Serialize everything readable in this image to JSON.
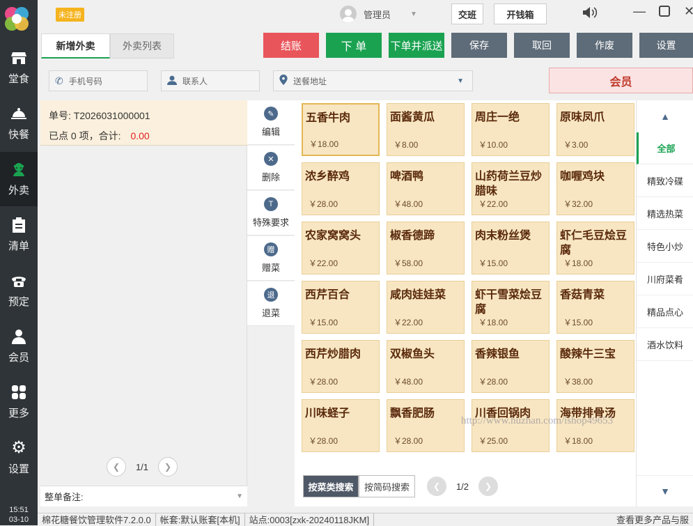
{
  "nav": {
    "items": [
      {
        "label": "堂食",
        "icon": "storefront-icon"
      },
      {
        "label": "快餐",
        "icon": "food-cloche-icon"
      },
      {
        "label": "外卖",
        "icon": "delivery-person-icon"
      },
      {
        "label": "清单",
        "icon": "clipboard-icon"
      },
      {
        "label": "预定",
        "icon": "phone-icon"
      },
      {
        "label": "会员",
        "icon": "user-icon"
      },
      {
        "label": "更多",
        "icon": "grid-icon"
      },
      {
        "label": "设置",
        "icon": "gear-icon"
      }
    ],
    "time": "15:51",
    "date": "03-10"
  },
  "topbar": {
    "badge": "未注册",
    "user": "管理员",
    "shift_btn": "交班",
    "drawer_btn": "开钱箱"
  },
  "tabs": [
    {
      "label": "新增外卖"
    },
    {
      "label": "外卖列表"
    }
  ],
  "actions": {
    "checkout": "结账",
    "order": "下 单",
    "order_dispatch": "下单并派送",
    "save": "保存",
    "recall": "取回",
    "void": "作废",
    "settings": "设置"
  },
  "search": {
    "phone": "手机号码",
    "contact": "联系人",
    "address": "送餐地址",
    "member": "会员"
  },
  "order": {
    "no_label": "单号:",
    "no": "T2026031000001",
    "summary": "已点 0 项，合计:",
    "total": "0.00",
    "page": "1/1",
    "remark_label": "整单备注:"
  },
  "tools": [
    {
      "label": "编辑",
      "icon": "pencil-icon",
      "glyph": "✎"
    },
    {
      "label": "删除",
      "icon": "close-icon",
      "glyph": "✕"
    },
    {
      "label": "特殊要求",
      "icon": "t-icon",
      "glyph": "T"
    },
    {
      "label": "赠菜",
      "icon": "gift-icon",
      "glyph": "赠"
    },
    {
      "label": "退菜",
      "icon": "return-icon",
      "glyph": "退"
    }
  ],
  "dishes": [
    {
      "name": "五香牛肉",
      "price": "￥18.00"
    },
    {
      "name": "面酱黄瓜",
      "price": "￥8.00"
    },
    {
      "name": "周庄一绝",
      "price": "￥10.00"
    },
    {
      "name": "原味凤爪",
      "price": "￥3.00"
    },
    {
      "name": "浓乡醉鸡",
      "price": "￥28.00"
    },
    {
      "name": "啤酒鸭",
      "price": "￥48.00"
    },
    {
      "name": "山药荷兰豆炒腊味",
      "price": "￥22.00"
    },
    {
      "name": "咖喱鸡块",
      "price": "￥32.00"
    },
    {
      "name": "农家窝窝头",
      "price": "￥22.00"
    },
    {
      "name": "椒香德蹄",
      "price": "￥58.00"
    },
    {
      "name": "肉末粉丝煲",
      "price": "￥15.00"
    },
    {
      "name": "虾仁毛豆烩豆腐",
      "price": "￥18.00"
    },
    {
      "name": "西芹百合",
      "price": "￥15.00"
    },
    {
      "name": "咸肉娃娃菜",
      "price": "￥22.00"
    },
    {
      "name": "虾干雪菜烩豆腐",
      "price": "￥18.00"
    },
    {
      "name": "香菇青菜",
      "price": "￥15.00"
    },
    {
      "name": "西芹炒腊肉",
      "price": "￥28.00"
    },
    {
      "name": "双椒鱼头",
      "price": "￥48.00"
    },
    {
      "name": "香辣银鱼",
      "price": "￥28.00"
    },
    {
      "name": "酸辣牛三宝",
      "price": "￥38.00"
    },
    {
      "name": "川味蛏子",
      "price": "￥28.00"
    },
    {
      "name": "飘香肥肠",
      "price": "￥28.00"
    },
    {
      "name": "川香回锅肉",
      "price": "￥25.00"
    },
    {
      "name": "海带排骨汤",
      "price": "￥18.00"
    }
  ],
  "grid_footer": {
    "by_category": "按菜类搜索",
    "by_code": "按简码搜索",
    "page": "1/2"
  },
  "categories": [
    "全部",
    "精致冷碟",
    "精选热菜",
    "特色小炒",
    "川府菜肴",
    "精品点心",
    "酒水饮料"
  ],
  "status": {
    "app": "棉花糖餐饮管理软件7.2.0.0",
    "account": "帐套:默认账套[本机]",
    "station": "站点:0003[zxk-20240118JKM]",
    "more": "查看更多产品与服"
  },
  "watermark": "http://www.huzhan.com/ishop49653",
  "colors": {
    "nav_bg": "#2f3438",
    "checkout": "#e8555a",
    "order": "#1aa251",
    "gray_btn": "#5e6b78",
    "dish_bg": "#f8e6c2",
    "accent_green": "#1aa251"
  }
}
